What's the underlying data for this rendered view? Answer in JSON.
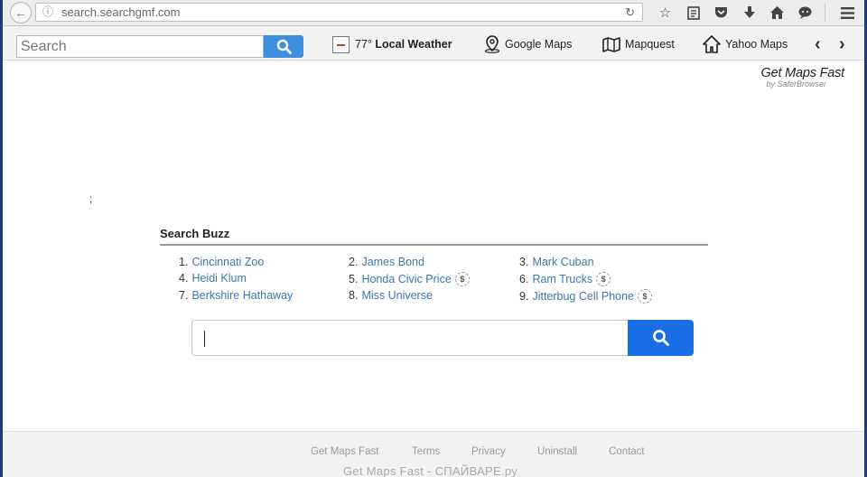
{
  "browser": {
    "url": "search.searchgmf.com",
    "icons": [
      "bookmark-star-icon",
      "reading-list-icon",
      "pocket-icon",
      "download-icon",
      "home-icon",
      "chat-icon",
      "menu-icon"
    ]
  },
  "toolbar": {
    "search_placeholder": "Search",
    "weather_temp": "77°",
    "weather_label": "Local Weather",
    "items": [
      {
        "label": "Google Maps",
        "icon": "map-pin-icon"
      },
      {
        "label": "Mapquest",
        "icon": "folded-map-icon"
      },
      {
        "label": "Yahoo Maps",
        "icon": "house-icon"
      }
    ]
  },
  "brand": {
    "title": "Get Maps Fast",
    "subtitle": "by SaferBrowser"
  },
  "buzz": {
    "title": "Search Buzz",
    "items": [
      {
        "num": "1.",
        "label": "Cincinnati Zoo",
        "badge": false
      },
      {
        "num": "2.",
        "label": "James Bond",
        "badge": false
      },
      {
        "num": "3.",
        "label": "Mark Cuban",
        "badge": false
      },
      {
        "num": "4.",
        "label": "Heidi Klum",
        "badge": false
      },
      {
        "num": "5.",
        "label": "Honda Civic Price",
        "badge": true
      },
      {
        "num": "6.",
        "label": "Ram Trucks",
        "badge": true
      },
      {
        "num": "7.",
        "label": "Berkshire Hathaway",
        "badge": false
      },
      {
        "num": "8.",
        "label": "Miss Universe",
        "badge": false
      },
      {
        "num": "9.",
        "label": "Jitterbug Cell Phone",
        "badge": true
      }
    ],
    "badge_symbol": "$"
  },
  "footer": {
    "links": [
      "Get Maps Fast",
      "Terms",
      "Privacy",
      "Uninstall",
      "Contact"
    ],
    "watermark": "Get  Maps  Fast - СПАЙВАРЕ.ру"
  },
  "colors": {
    "search_button": "#1a6ee6",
    "toolbar_search_button": "#3e8fe0",
    "link": "#3d76b0"
  }
}
